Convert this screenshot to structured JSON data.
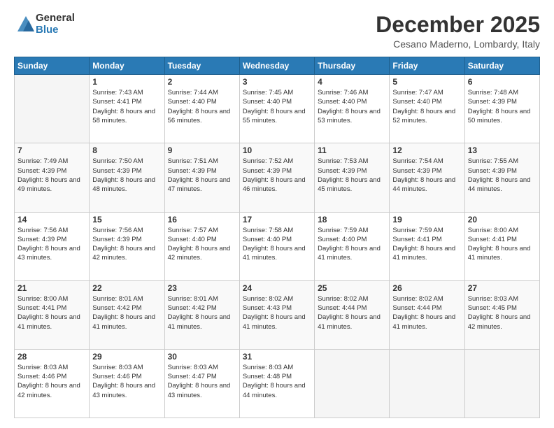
{
  "logo": {
    "general": "General",
    "blue": "Blue"
  },
  "header": {
    "month": "December 2025",
    "location": "Cesano Maderno, Lombardy, Italy"
  },
  "weekdays": [
    "Sunday",
    "Monday",
    "Tuesday",
    "Wednesday",
    "Thursday",
    "Friday",
    "Saturday"
  ],
  "weeks": [
    [
      {
        "day": "",
        "sunrise": "",
        "sunset": "",
        "daylight": ""
      },
      {
        "day": "1",
        "sunrise": "Sunrise: 7:43 AM",
        "sunset": "Sunset: 4:41 PM",
        "daylight": "Daylight: 8 hours and 58 minutes."
      },
      {
        "day": "2",
        "sunrise": "Sunrise: 7:44 AM",
        "sunset": "Sunset: 4:40 PM",
        "daylight": "Daylight: 8 hours and 56 minutes."
      },
      {
        "day": "3",
        "sunrise": "Sunrise: 7:45 AM",
        "sunset": "Sunset: 4:40 PM",
        "daylight": "Daylight: 8 hours and 55 minutes."
      },
      {
        "day": "4",
        "sunrise": "Sunrise: 7:46 AM",
        "sunset": "Sunset: 4:40 PM",
        "daylight": "Daylight: 8 hours and 53 minutes."
      },
      {
        "day": "5",
        "sunrise": "Sunrise: 7:47 AM",
        "sunset": "Sunset: 4:40 PM",
        "daylight": "Daylight: 8 hours and 52 minutes."
      },
      {
        "day": "6",
        "sunrise": "Sunrise: 7:48 AM",
        "sunset": "Sunset: 4:39 PM",
        "daylight": "Daylight: 8 hours and 50 minutes."
      }
    ],
    [
      {
        "day": "7",
        "sunrise": "Sunrise: 7:49 AM",
        "sunset": "Sunset: 4:39 PM",
        "daylight": "Daylight: 8 hours and 49 minutes."
      },
      {
        "day": "8",
        "sunrise": "Sunrise: 7:50 AM",
        "sunset": "Sunset: 4:39 PM",
        "daylight": "Daylight: 8 hours and 48 minutes."
      },
      {
        "day": "9",
        "sunrise": "Sunrise: 7:51 AM",
        "sunset": "Sunset: 4:39 PM",
        "daylight": "Daylight: 8 hours and 47 minutes."
      },
      {
        "day": "10",
        "sunrise": "Sunrise: 7:52 AM",
        "sunset": "Sunset: 4:39 PM",
        "daylight": "Daylight: 8 hours and 46 minutes."
      },
      {
        "day": "11",
        "sunrise": "Sunrise: 7:53 AM",
        "sunset": "Sunset: 4:39 PM",
        "daylight": "Daylight: 8 hours and 45 minutes."
      },
      {
        "day": "12",
        "sunrise": "Sunrise: 7:54 AM",
        "sunset": "Sunset: 4:39 PM",
        "daylight": "Daylight: 8 hours and 44 minutes."
      },
      {
        "day": "13",
        "sunrise": "Sunrise: 7:55 AM",
        "sunset": "Sunset: 4:39 PM",
        "daylight": "Daylight: 8 hours and 44 minutes."
      }
    ],
    [
      {
        "day": "14",
        "sunrise": "Sunrise: 7:56 AM",
        "sunset": "Sunset: 4:39 PM",
        "daylight": "Daylight: 8 hours and 43 minutes."
      },
      {
        "day": "15",
        "sunrise": "Sunrise: 7:56 AM",
        "sunset": "Sunset: 4:39 PM",
        "daylight": "Daylight: 8 hours and 42 minutes."
      },
      {
        "day": "16",
        "sunrise": "Sunrise: 7:57 AM",
        "sunset": "Sunset: 4:40 PM",
        "daylight": "Daylight: 8 hours and 42 minutes."
      },
      {
        "day": "17",
        "sunrise": "Sunrise: 7:58 AM",
        "sunset": "Sunset: 4:40 PM",
        "daylight": "Daylight: 8 hours and 41 minutes."
      },
      {
        "day": "18",
        "sunrise": "Sunrise: 7:59 AM",
        "sunset": "Sunset: 4:40 PM",
        "daylight": "Daylight: 8 hours and 41 minutes."
      },
      {
        "day": "19",
        "sunrise": "Sunrise: 7:59 AM",
        "sunset": "Sunset: 4:41 PM",
        "daylight": "Daylight: 8 hours and 41 minutes."
      },
      {
        "day": "20",
        "sunrise": "Sunrise: 8:00 AM",
        "sunset": "Sunset: 4:41 PM",
        "daylight": "Daylight: 8 hours and 41 minutes."
      }
    ],
    [
      {
        "day": "21",
        "sunrise": "Sunrise: 8:00 AM",
        "sunset": "Sunset: 4:41 PM",
        "daylight": "Daylight: 8 hours and 41 minutes."
      },
      {
        "day": "22",
        "sunrise": "Sunrise: 8:01 AM",
        "sunset": "Sunset: 4:42 PM",
        "daylight": "Daylight: 8 hours and 41 minutes."
      },
      {
        "day": "23",
        "sunrise": "Sunrise: 8:01 AM",
        "sunset": "Sunset: 4:42 PM",
        "daylight": "Daylight: 8 hours and 41 minutes."
      },
      {
        "day": "24",
        "sunrise": "Sunrise: 8:02 AM",
        "sunset": "Sunset: 4:43 PM",
        "daylight": "Daylight: 8 hours and 41 minutes."
      },
      {
        "day": "25",
        "sunrise": "Sunrise: 8:02 AM",
        "sunset": "Sunset: 4:44 PM",
        "daylight": "Daylight: 8 hours and 41 minutes."
      },
      {
        "day": "26",
        "sunrise": "Sunrise: 8:02 AM",
        "sunset": "Sunset: 4:44 PM",
        "daylight": "Daylight: 8 hours and 41 minutes."
      },
      {
        "day": "27",
        "sunrise": "Sunrise: 8:03 AM",
        "sunset": "Sunset: 4:45 PM",
        "daylight": "Daylight: 8 hours and 42 minutes."
      }
    ],
    [
      {
        "day": "28",
        "sunrise": "Sunrise: 8:03 AM",
        "sunset": "Sunset: 4:46 PM",
        "daylight": "Daylight: 8 hours and 42 minutes."
      },
      {
        "day": "29",
        "sunrise": "Sunrise: 8:03 AM",
        "sunset": "Sunset: 4:46 PM",
        "daylight": "Daylight: 8 hours and 43 minutes."
      },
      {
        "day": "30",
        "sunrise": "Sunrise: 8:03 AM",
        "sunset": "Sunset: 4:47 PM",
        "daylight": "Daylight: 8 hours and 43 minutes."
      },
      {
        "day": "31",
        "sunrise": "Sunrise: 8:03 AM",
        "sunset": "Sunset: 4:48 PM",
        "daylight": "Daylight: 8 hours and 44 minutes."
      },
      {
        "day": "",
        "sunrise": "",
        "sunset": "",
        "daylight": ""
      },
      {
        "day": "",
        "sunrise": "",
        "sunset": "",
        "daylight": ""
      },
      {
        "day": "",
        "sunrise": "",
        "sunset": "",
        "daylight": ""
      }
    ]
  ]
}
